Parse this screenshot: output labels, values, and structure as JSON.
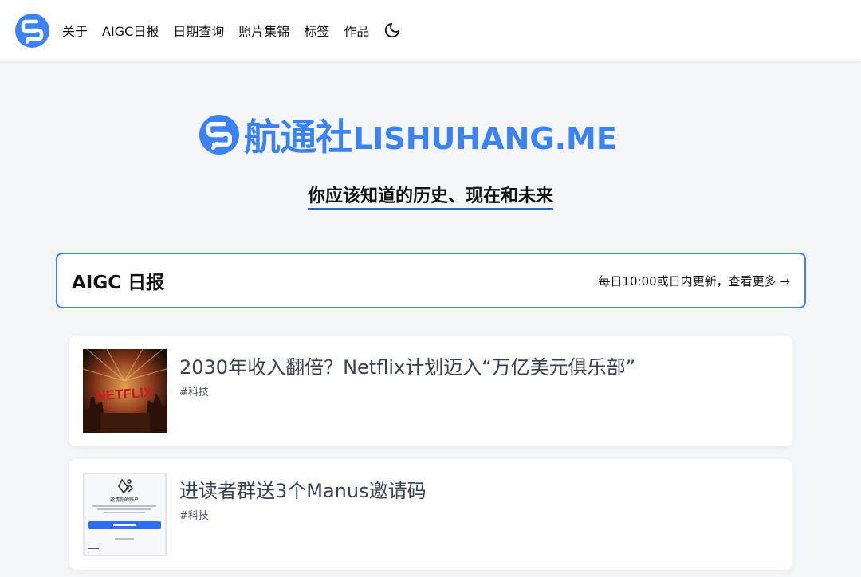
{
  "nav": {
    "items": [
      "关于",
      "AIGC日报",
      "日期查询",
      "照片集锦",
      "标签",
      "作品"
    ]
  },
  "brand": {
    "name_cn": "航通社",
    "domain": "LISHUHANG.ME",
    "tagline": "你应该知道的历史、现在和未来"
  },
  "aigc": {
    "title": "AIGC 日报",
    "more_link": "每日10:00或日内更新，查看更多 →"
  },
  "articles": [
    {
      "title": "2030年收入翻倍？Netflix计划迈入“万亿美元俱乐部”",
      "tag": "#科技",
      "thumb_text": "NETFLIX"
    },
    {
      "title": "进读者群送3个Manus邀请码",
      "tag": "#科技",
      "thumb_text": "邀请你的账户"
    }
  ],
  "colors": {
    "accent": "#3b82f6",
    "tagline_underline": "#2f5fb0",
    "background": "#f5f6f9"
  }
}
